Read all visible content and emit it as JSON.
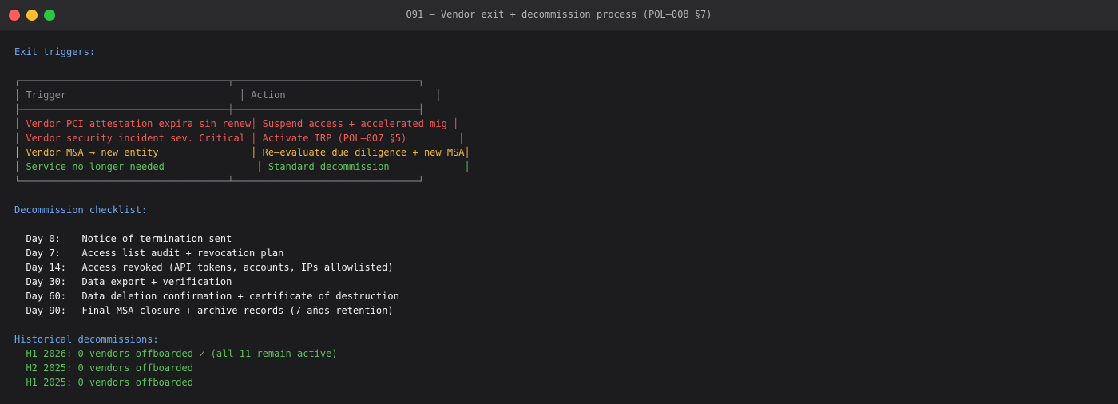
{
  "window": {
    "title": "Q91 — Vendor exit + decommission process (POL–008 §7)"
  },
  "triggers": {
    "heading": "Exit triggers:",
    "border_top": "┌────────────────────────────────────┬────────────────────────────────┐",
    "header_line": "│ Trigger                              │ Action                          │",
    "border_mid": "├────────────────────────────────────┼────────────────────────────────┤",
    "rows": [
      {
        "line": "│ Vendor PCI attestation expira sin renew│ Suspend access + accelerated mig │",
        "severity": "red"
      },
      {
        "line": "│ Vendor security incident sev. Critical │ Activate IRP (POL–007 §5)         │",
        "severity": "red"
      },
      {
        "line": "│ Vendor M&A → new entity                │ Re–evaluate due diligence + new MSA│",
        "severity": "yellow"
      },
      {
        "line": "│ Service no longer needed                │ Standard decommission             │",
        "severity": "green"
      }
    ],
    "border_bottom": "└────────────────────────────────────┴────────────────────────────────┘"
  },
  "checklist": {
    "heading": "Decommission checklist:",
    "items": [
      {
        "day": "Day 0:",
        "task": "Notice of termination sent"
      },
      {
        "day": "Day 7:",
        "task": "Access list audit + revocation plan"
      },
      {
        "day": "Day 14:",
        "task": "Access revoked (API tokens, accounts, IPs allowlisted)"
      },
      {
        "day": "Day 30:",
        "task": "Data export + verification"
      },
      {
        "day": "Day 60:",
        "task": "Data deletion confirmation + certificate of destruction"
      },
      {
        "day": "Day 90:",
        "task": "Final MSA closure + archive records (7 años retention)"
      }
    ]
  },
  "history": {
    "heading": "Historical decommissions:",
    "items": [
      "H1 2026: 0 vendors offboarded ✓ (all 11 remain active)",
      "H2 2025: 0 vendors offboarded",
      "H1 2025: 0 vendors offboarded"
    ]
  },
  "colors": {
    "red": "#f05b57",
    "yellow": "#f0b93a",
    "green": "#5cc45c",
    "blue": "#6fa8f0"
  }
}
